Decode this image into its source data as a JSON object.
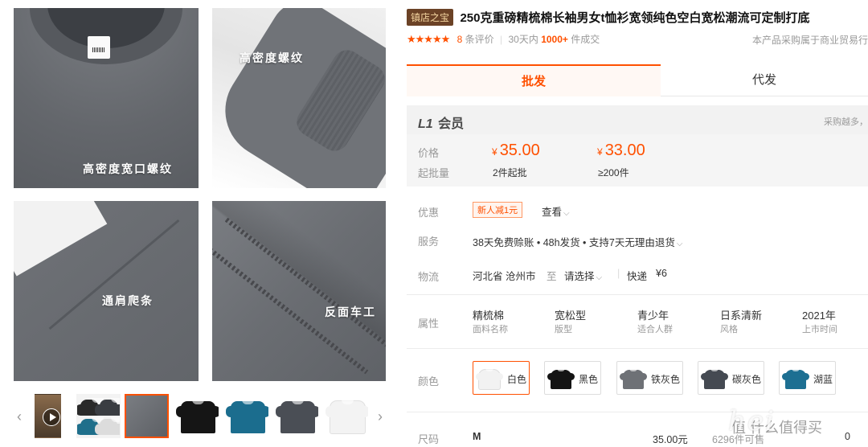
{
  "gallery": {
    "captions": [
      "高密度宽口螺纹",
      "高密度螺纹",
      "通肩爬条",
      "反面车工"
    ],
    "thumbnails": [
      {
        "kind": "video",
        "colors": [
          "#8a6b4c"
        ]
      },
      {
        "kind": "multi",
        "colors": [
          "#2a2a2a",
          "#1f6f8b"
        ]
      },
      {
        "kind": "detail",
        "colors": [
          "#6b6e73"
        ]
      },
      {
        "kind": "tshirt",
        "colors": [
          "#151515"
        ]
      },
      {
        "kind": "tshirt",
        "colors": [
          "#1b6d8e"
        ]
      },
      {
        "kind": "tshirt",
        "colors": [
          "#4a4e55"
        ]
      },
      {
        "kind": "tshirt",
        "colors": [
          "#f3f3f3"
        ]
      }
    ],
    "prev_arrow": "‹",
    "next_arrow": "›"
  },
  "product": {
    "badge": "镇店之宝",
    "title": "250克重磅精梳棉长袖男女t恤衫宽领纯色空白宽松潮流可定制打底",
    "stars": "★★★★★",
    "review_count": "8",
    "review_label": "条评价",
    "sales_prefix": "30天内",
    "sales_value": "1000+",
    "sales_suffix": "件成交",
    "compliance_note": "本产品采购属于商业贸易行"
  },
  "tabs": {
    "wholesale": "批发",
    "dropship": "代发"
  },
  "member": {
    "level": "L1",
    "level_label": "会员",
    "hint": "采购越多，"
  },
  "pricing": {
    "price_label": "价格",
    "moq_label": "起批量",
    "currency": "¥",
    "tiers": [
      {
        "price": "35.00",
        "condition": "2件起批"
      },
      {
        "price": "33.00",
        "condition": "≥200件"
      }
    ]
  },
  "promo": {
    "label": "优惠",
    "tag": "新人减1元",
    "view": "查看"
  },
  "service": {
    "label": "服务",
    "text": "38天免费赊账 • 48h发货 • 支持7天无理由退货"
  },
  "logistics": {
    "label": "物流",
    "origin": "河北省 沧州市",
    "to": "至",
    "select": "请选择",
    "express": "快递",
    "fee": "¥6"
  },
  "attributes": {
    "label": "属性",
    "items": [
      {
        "value": "精梳棉",
        "key": "面料名称"
      },
      {
        "value": "宽松型",
        "key": "版型"
      },
      {
        "value": "青少年",
        "key": "适合人群"
      },
      {
        "value": "日系清新",
        "key": "风格"
      },
      {
        "value": "2021年",
        "key": "上市时间"
      }
    ]
  },
  "colors": {
    "label": "颜色",
    "options": [
      {
        "name": "白色",
        "swatch": "#f2f2f2",
        "selected": true
      },
      {
        "name": "黑色",
        "swatch": "#141414",
        "selected": false
      },
      {
        "name": "铁灰色",
        "swatch": "#6e7176",
        "selected": false
      },
      {
        "name": "碳灰色",
        "swatch": "#454a52",
        "selected": false
      },
      {
        "name": "湖蓝",
        "swatch": "#1d6f92",
        "selected": false
      }
    ]
  },
  "size": {
    "label": "尺码",
    "value": "M",
    "price": "35.00元",
    "stock": "6296件可售",
    "qty": "0"
  },
  "watermark": {
    "text": "hei",
    "sub": "值 什么值得买"
  },
  "accent_color": "#ff5000"
}
